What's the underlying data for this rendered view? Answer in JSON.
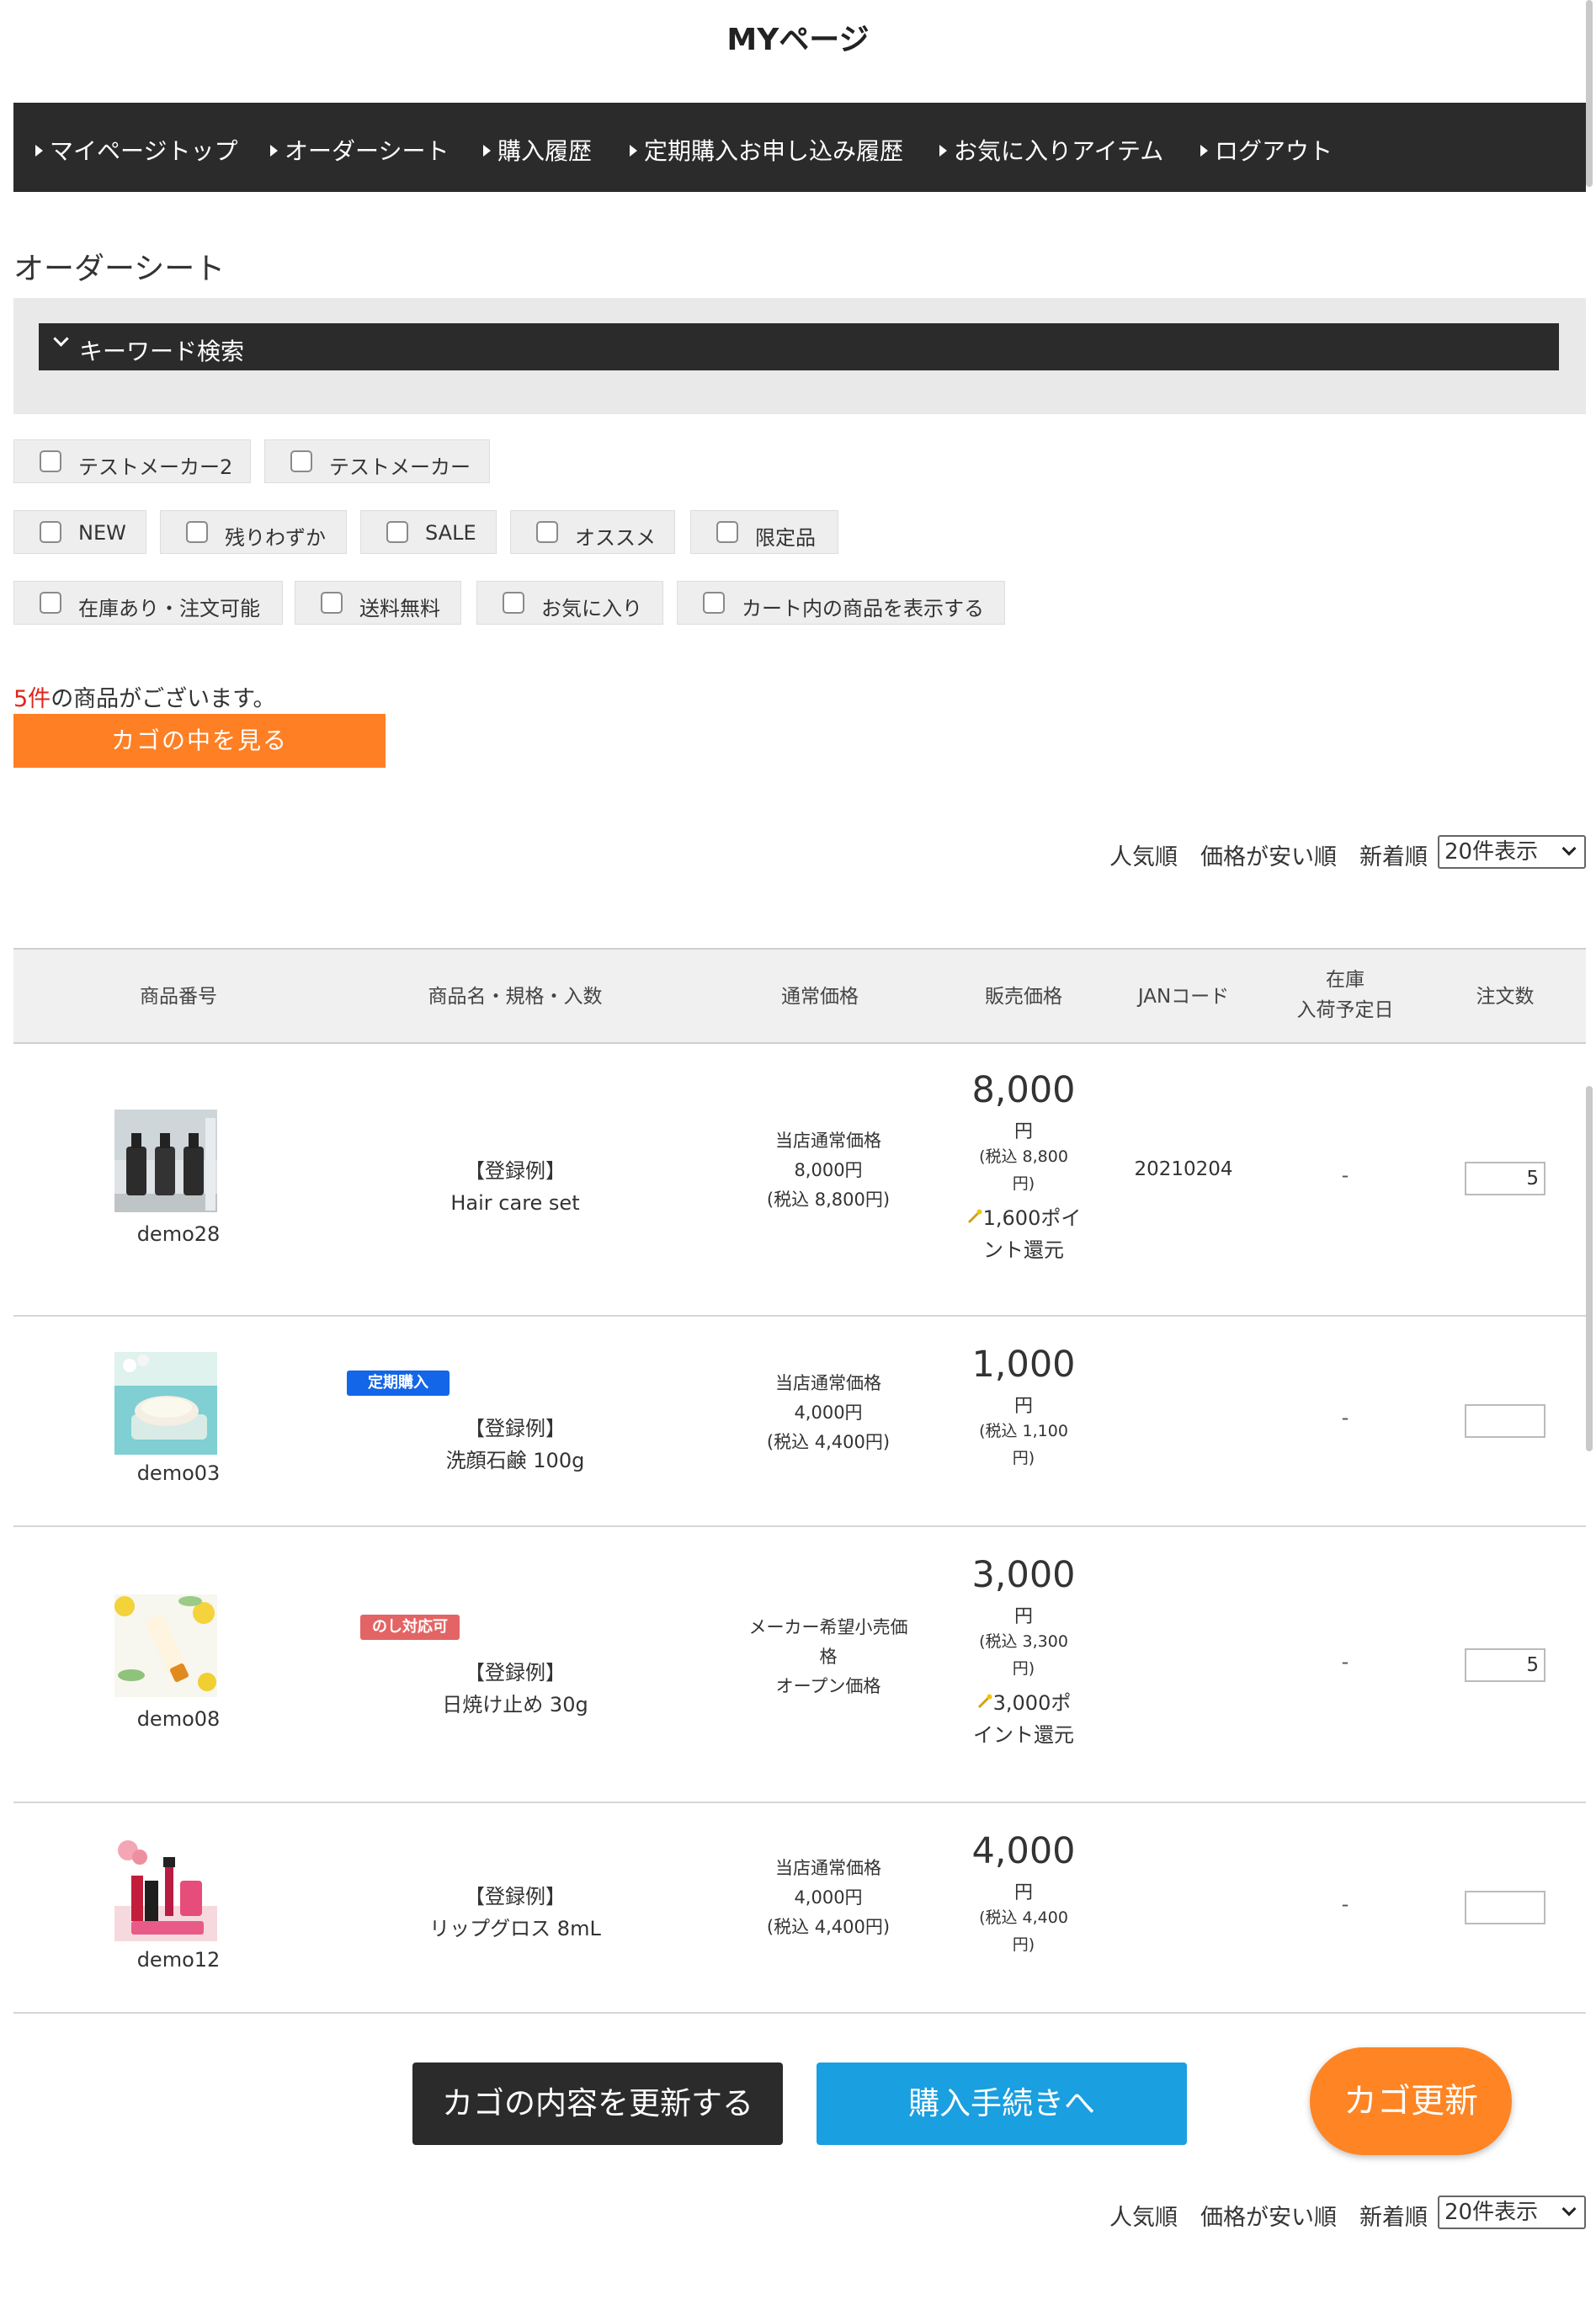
{
  "page": {
    "title": "MYページ"
  },
  "nav": {
    "items": [
      {
        "label": "マイページトップ"
      },
      {
        "label": "オーダーシート"
      },
      {
        "label": "購入履歴"
      },
      {
        "label": "定期購入お申し込み履歴"
      },
      {
        "label": "お気に入りアイテム"
      },
      {
        "label": "ログアウト"
      }
    ]
  },
  "section": {
    "title": "オーダーシート"
  },
  "search": {
    "label": "キーワード検索"
  },
  "filters": {
    "makers": [
      "テストメーカー2",
      "テストメーカー"
    ],
    "tags": [
      "NEW",
      "残りわずか",
      "SALE",
      "オススメ",
      "限定品"
    ],
    "options": [
      "在庫あり・注文可能",
      "送料無料",
      "お気に入り",
      "カート内の商品を表示する"
    ]
  },
  "cart": {
    "count": "5件",
    "count_suffix": "の商品がございます。",
    "view_button": "カゴの中を見る"
  },
  "sort": {
    "popular": "人気順",
    "price_low": "価格が安い順",
    "newest": "新着順",
    "per_page": "20件表示"
  },
  "table": {
    "headers": {
      "product_no": "商品番号",
      "name": "商品名・規格・入数",
      "regular_price": "通常価格",
      "sale_price": "販売価格",
      "jan": "JANコード",
      "stock_1": "在庫",
      "stock_2": "入荷予定日",
      "qty": "注文数"
    },
    "rows": [
      {
        "code": "demo28",
        "prefix": "【登録例】",
        "name": "Hair care set",
        "badge": "",
        "reg_1": "当店通常価格",
        "reg_2": "8,000円",
        "reg_3": "(税込 8,800円)",
        "price": "8,000",
        "yen": "円",
        "tax_1": "(税込 8,800",
        "tax_2": "円)",
        "points_1": "1,600ポイ",
        "points_2": "ント還元",
        "jan": "20210204",
        "stock": "-",
        "qty": "5"
      },
      {
        "code": "demo03",
        "prefix": "【登録例】",
        "name": "洗顔石鹸 100g",
        "badge": "定期購入",
        "reg_1": "当店通常価格",
        "reg_2": "4,000円",
        "reg_3": "(税込 4,400円)",
        "price": "1,000",
        "yen": "円",
        "tax_1": "(税込 1,100",
        "tax_2": "円)",
        "points_1": "",
        "points_2": "",
        "jan": "",
        "stock": "-",
        "qty": ""
      },
      {
        "code": "demo08",
        "prefix": "【登録例】",
        "name": "日焼け止め 30g",
        "badge": "のし対応可",
        "reg_1": "メーカー希望小売価",
        "reg_2": "格",
        "reg_3": "オープン価格",
        "price": "3,000",
        "yen": "円",
        "tax_1": "(税込 3,300",
        "tax_2": "円)",
        "points_1": "3,000ポ",
        "points_2": "イント還元",
        "jan": "",
        "stock": "-",
        "qty": "5"
      },
      {
        "code": "demo12",
        "prefix": "【登録例】",
        "name": "リップグロス 8mL",
        "badge": "",
        "reg_1": "当店通常価格",
        "reg_2": "4,000円",
        "reg_3": "(税込 4,400円)",
        "price": "4,000",
        "yen": "円",
        "tax_1": "(税込 4,400",
        "tax_2": "円)",
        "points_1": "",
        "points_2": "",
        "jan": "",
        "stock": "-",
        "qty": ""
      }
    ]
  },
  "actions": {
    "update_cart": "カゴの内容を更新する",
    "checkout": "購入手続きへ",
    "cart_update_float": "カゴ更新"
  },
  "colors": {
    "nav_bg": "#2b2b2b",
    "accent_orange": "#ff7f24",
    "checkout_blue": "#1a9fe0",
    "count_red": "#e0261b",
    "badge_blue": "#1366e8",
    "badge_red": "#e36464"
  }
}
